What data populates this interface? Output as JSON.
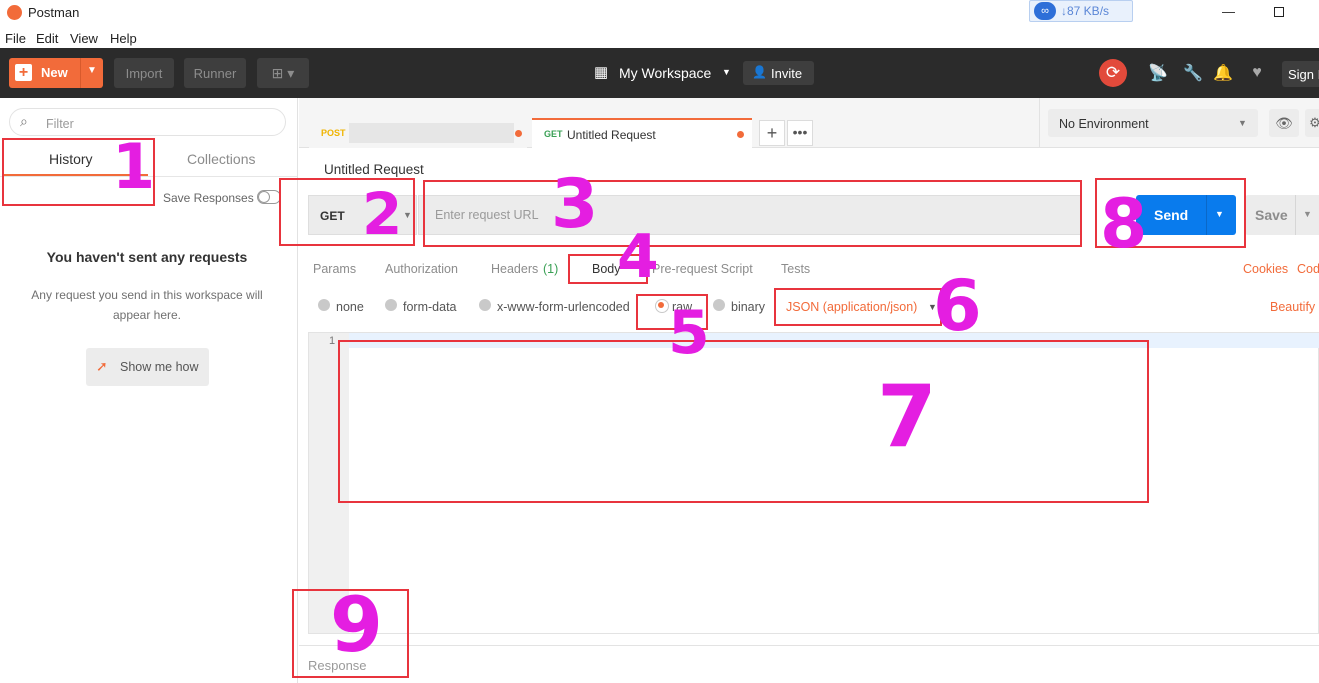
{
  "window": {
    "title": "Postman",
    "net_speed": "↓87 KB/s"
  },
  "menu": [
    "File",
    "Edit",
    "View",
    "Help"
  ],
  "toolbar": {
    "new_label": "New",
    "import_label": "Import",
    "runner_label": "Runner",
    "workspace_label": "My Workspace",
    "invite_label": "Invite",
    "sign_in_label": "Sign I"
  },
  "sidebar": {
    "filter_placeholder": "Filter",
    "tab_history": "History",
    "tab_collections": "Collections",
    "save_responses_label": "Save Responses",
    "empty_title": "You haven't sent any requests",
    "empty_text": "Any request you send in this workspace will appear here.",
    "show_me_how": "Show me how"
  },
  "tabs": [
    {
      "method": "POST",
      "name": ""
    },
    {
      "method": "GET",
      "name": "Untitled Request"
    }
  ],
  "environment": {
    "selected": "No Environment"
  },
  "request": {
    "title": "Untitled Request",
    "method": "GET",
    "url_placeholder": "Enter request URL",
    "send_label": "Send",
    "save_label": "Save"
  },
  "request_tabs": {
    "params": "Params",
    "authorization": "Authorization",
    "headers": "Headers",
    "headers_count": "(1)",
    "body": "Body",
    "prerequest": "Pre-request Script",
    "tests": "Tests",
    "cookies": "Cookies",
    "code": "Code"
  },
  "body_types": {
    "none": "none",
    "form_data": "form-data",
    "urlencoded": "x-www-form-urlencoded",
    "raw": "raw",
    "binary": "binary",
    "content_type": "JSON (application/json)",
    "beautify": "Beautify"
  },
  "editor": {
    "line_number": "1"
  },
  "response": {
    "label": "Response"
  },
  "annotations": [
    "1",
    "2",
    "3",
    "4",
    "5",
    "6",
    "7",
    "8",
    "9"
  ],
  "colors": {
    "accent": "#f26b3a",
    "send_blue": "#097bed",
    "annotation_box": "#e8343d",
    "annotation_number": "#e41ee1"
  }
}
